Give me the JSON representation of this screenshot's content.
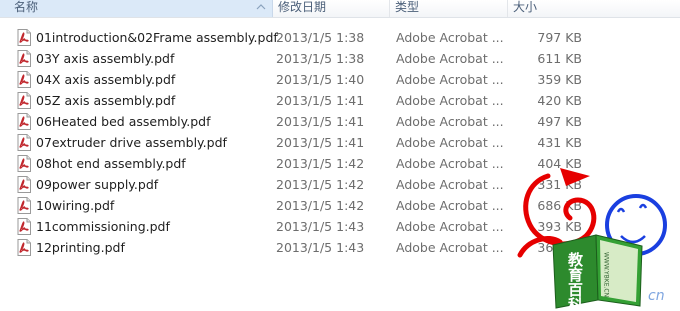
{
  "columns": {
    "name": "名称",
    "date": "修改日期",
    "type": "类型",
    "size": "大小"
  },
  "files": [
    {
      "name": "01introduction&02Frame assembly.pdf",
      "date": "2013/1/5 1:38",
      "type": "Adobe Acrobat ...",
      "size": "797 KB"
    },
    {
      "name": "03Y axis assembly.pdf",
      "date": "2013/1/5 1:38",
      "type": "Adobe Acrobat ...",
      "size": "611 KB"
    },
    {
      "name": "04X axis assembly.pdf",
      "date": "2013/1/5 1:40",
      "type": "Adobe Acrobat ...",
      "size": "359 KB"
    },
    {
      "name": "05Z axis assembly.pdf",
      "date": "2013/1/5 1:41",
      "type": "Adobe Acrobat ...",
      "size": "420 KB"
    },
    {
      "name": "06Heated bed assembly.pdf",
      "date": "2013/1/5 1:41",
      "type": "Adobe Acrobat ...",
      "size": "497 KB"
    },
    {
      "name": "07extruder drive assembly.pdf",
      "date": "2013/1/5 1:41",
      "type": "Adobe Acrobat ...",
      "size": "431 KB"
    },
    {
      "name": "08hot end assembly.pdf",
      "date": "2013/1/5 1:42",
      "type": "Adobe Acrobat ...",
      "size": "404 KB"
    },
    {
      "name": "09power supply.pdf",
      "date": "2013/1/5 1:42",
      "type": "Adobe Acrobat ...",
      "size": "331 KB"
    },
    {
      "name": "10wiring.pdf",
      "date": "2013/1/5 1:42",
      "type": "Adobe Acrobat ...",
      "size": "686 KB"
    },
    {
      "name": "11commissioning.pdf",
      "date": "2013/1/5 1:43",
      "type": "Adobe Acrobat ...",
      "size": "393 KB"
    },
    {
      "name": "12printing.pdf",
      "date": "2013/1/5 1:43",
      "type": "Adobe Acrobat ...",
      "size": "360 KB"
    }
  ],
  "watermark": {
    "book_text": "教育百科",
    "url_text": "WWW.YBKE.CN",
    "domain_text": "cn"
  },
  "colors": {
    "header_selected": "#dbe9f8",
    "header_text": "#4c607a",
    "pdf_red": "#c1272d",
    "watermark_red": "#e60000",
    "watermark_blue": "#1a3fe0",
    "watermark_green": "#2d8a2d"
  }
}
